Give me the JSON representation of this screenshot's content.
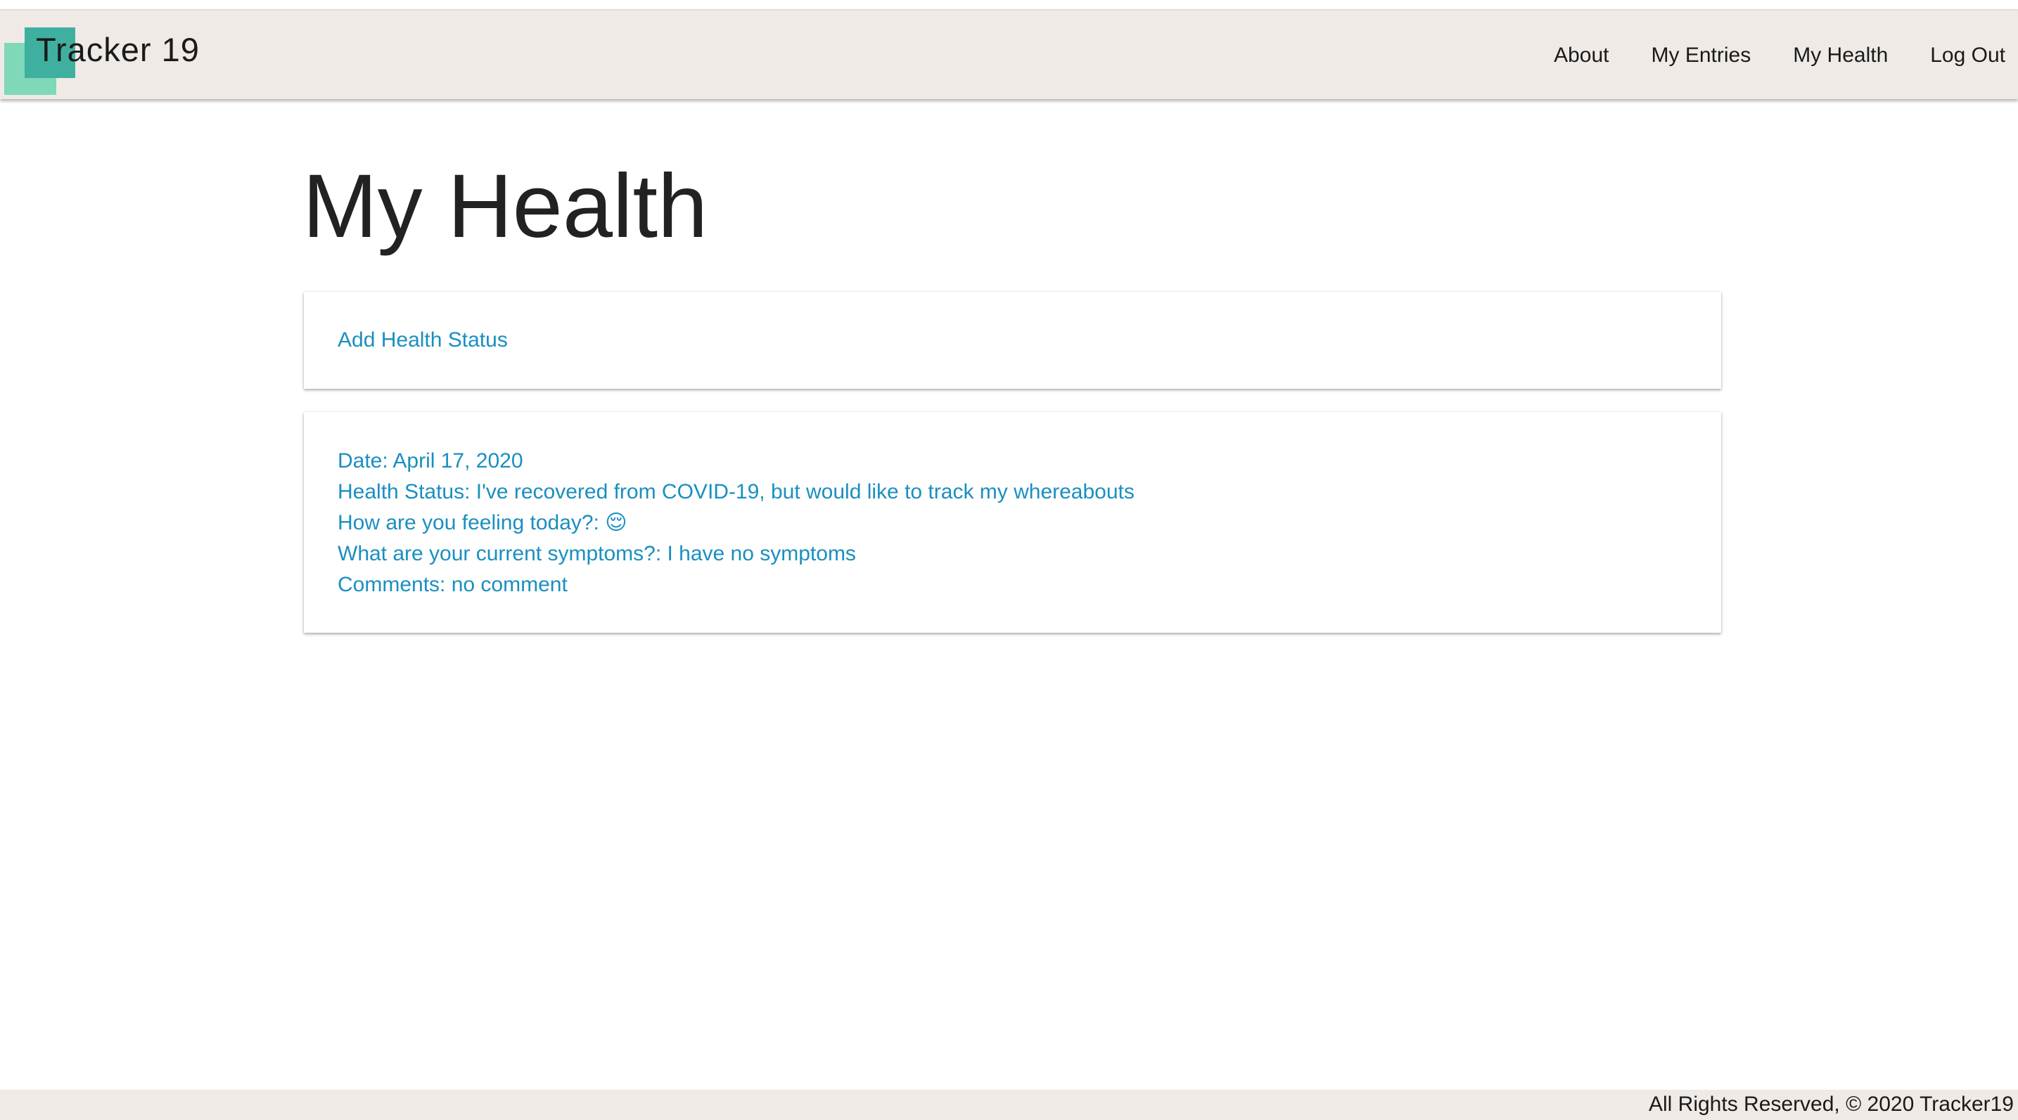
{
  "navbar": {
    "brand": "Tracker 19",
    "links": [
      "About",
      "My Entries",
      "My Health",
      "Log Out"
    ]
  },
  "page": {
    "title": "My Health"
  },
  "add_card": {
    "label": "Add Health Status"
  },
  "entry": {
    "date": "Date: April 17, 2020",
    "health_status": "Health Status: I've recovered from COVID-19, but would like to track my whereabouts",
    "feeling": "How are you feeling today?: 😌",
    "symptoms": "What are your current symptoms?: I have no symptoms",
    "comments": "Comments: no comment"
  },
  "footer": {
    "text": "All Rights Reserved, © 2020 Tracker19"
  },
  "colors": {
    "navbar_bg": "#efeae6",
    "logo_front": "#3fb0a0",
    "logo_back": "#7fd8b8",
    "link": "#1a8fbf",
    "title": "#222222"
  }
}
